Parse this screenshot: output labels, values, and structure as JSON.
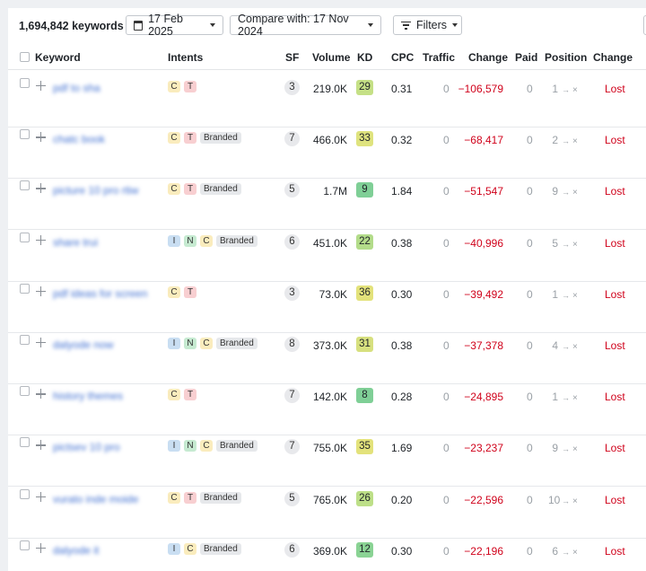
{
  "toolbar": {
    "keyword_count": "1,694,842 keywords",
    "date_label": "17 Feb 2025",
    "compare_label": "Compare with: 17 Nov 2024",
    "filters_label": "Filters"
  },
  "columns": {
    "keyword": "Keyword",
    "intents": "Intents",
    "sf": "SF",
    "volume": "Volume",
    "kd": "KD",
    "cpc": "CPC",
    "traffic": "Traffic",
    "change": "Change",
    "paid": "Paid",
    "position": "Position",
    "change2": "Change"
  },
  "rows": [
    {
      "keyword": "pdf to sha",
      "intents": [
        "C",
        "T"
      ],
      "branded": "",
      "sf": "3",
      "volume": "219.0K",
      "kd": "29",
      "kd_color": "#c5e086",
      "cpc": "0.31",
      "traffic": "0",
      "change": "−106,579",
      "paid": "0",
      "pos_from": "1",
      "pos_to": "×",
      "status": "Lost"
    },
    {
      "keyword": "chatc book",
      "intents": [
        "C",
        "T"
      ],
      "branded": "Branded",
      "sf": "7",
      "volume": "466.0K",
      "kd": "33",
      "kd_color": "#dfe37e",
      "cpc": "0.32",
      "traffic": "0",
      "change": "−68,417",
      "paid": "0",
      "pos_from": "2",
      "pos_to": "×",
      "status": "Lost"
    },
    {
      "keyword": "picture 10 pro rtiw",
      "intents": [
        "C",
        "T"
      ],
      "branded": "Branded",
      "sf": "5",
      "volume": "1.7M",
      "kd": "9",
      "kd_color": "#7fcf96",
      "cpc": "1.84",
      "traffic": "0",
      "change": "−51,547",
      "paid": "0",
      "pos_from": "9",
      "pos_to": "×",
      "status": "Lost"
    },
    {
      "keyword": "share trui",
      "intents": [
        "I",
        "N",
        "C"
      ],
      "branded": "Branded",
      "sf": "6",
      "volume": "451.0K",
      "kd": "22",
      "kd_color": "#b3dc8a",
      "cpc": "0.38",
      "traffic": "0",
      "change": "−40,996",
      "paid": "0",
      "pos_from": "5",
      "pos_to": "×",
      "status": "Lost"
    },
    {
      "keyword": "pdf ideas for screen",
      "intents": [
        "C",
        "T"
      ],
      "branded": "",
      "sf": "3",
      "volume": "73.0K",
      "kd": "36",
      "kd_color": "#e3e27b",
      "cpc": "0.30",
      "traffic": "0",
      "change": "−39,492",
      "paid": "0",
      "pos_from": "1",
      "pos_to": "×",
      "status": "Lost"
    },
    {
      "keyword": "dalyode now",
      "intents": [
        "I",
        "N",
        "C"
      ],
      "branded": "Branded",
      "sf": "8",
      "volume": "373.0K",
      "kd": "31",
      "kd_color": "#d7e07f",
      "cpc": "0.38",
      "traffic": "0",
      "change": "−37,378",
      "paid": "0",
      "pos_from": "4",
      "pos_to": "×",
      "status": "Lost"
    },
    {
      "keyword": "history themes",
      "intents": [
        "C",
        "T"
      ],
      "branded": "",
      "sf": "7",
      "volume": "142.0K",
      "kd": "8",
      "kd_color": "#7fcf96",
      "cpc": "0.28",
      "traffic": "0",
      "change": "−24,895",
      "paid": "0",
      "pos_from": "1",
      "pos_to": "×",
      "status": "Lost"
    },
    {
      "keyword": "pictsev 10 pro",
      "intents": [
        "I",
        "N",
        "C"
      ],
      "branded": "Branded",
      "sf": "7",
      "volume": "755.0K",
      "kd": "35",
      "kd_color": "#e3e27b",
      "cpc": "1.69",
      "traffic": "0",
      "change": "−23,237",
      "paid": "0",
      "pos_from": "9",
      "pos_to": "×",
      "status": "Lost"
    },
    {
      "keyword": "vurato inde moide",
      "intents": [
        "C",
        "T"
      ],
      "branded": "Branded",
      "sf": "5",
      "volume": "765.0K",
      "kd": "26",
      "kd_color": "#bddf88",
      "cpc": "0.20",
      "traffic": "0",
      "change": "−22,596",
      "paid": "0",
      "pos_from": "10",
      "pos_to": "×",
      "status": "Lost"
    },
    {
      "keyword": "dalyode it",
      "intents": [
        "I",
        "C"
      ],
      "branded": "Branded",
      "sf": "6",
      "volume": "369.0K",
      "kd": "12",
      "kd_color": "#8ad394",
      "cpc": "0.30",
      "traffic": "0",
      "change": "−22,196",
      "paid": "0",
      "pos_from": "6",
      "pos_to": "×",
      "status": "Lost"
    }
  ]
}
